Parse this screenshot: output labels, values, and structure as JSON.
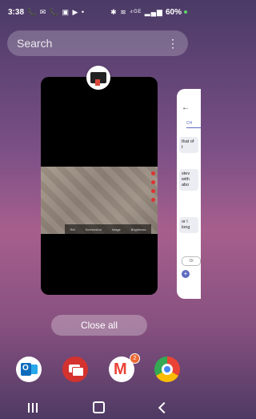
{
  "status_bar": {
    "time": "3:38",
    "left_icons": "📞 ✉ 📞 ▣ ▶ •",
    "right_icons": "✱ ≋ ⁴ᴳᴱ ▂▄▆",
    "battery": "60%",
    "left_icon_names": [
      "phone-icon",
      "voicemail-icon",
      "phone-icon",
      "gallery-icon",
      "youtube-icon"
    ],
    "right_icon_names": [
      "bluetooth-icon",
      "wifi-icon",
      "lte-icon",
      "signal-icon"
    ]
  },
  "search": {
    "placeholder": "Search"
  },
  "recent_app": {
    "name": "connect"
  },
  "side_card": {
    "tab": "CH",
    "messages": [
      "that of t",
      "stev with abo",
      "or l long"
    ],
    "chip": "Ol"
  },
  "close_all": {
    "label": "Close all"
  },
  "dock": {
    "apps": [
      "Outlook",
      "Messages",
      "Gmail",
      "Chrome"
    ],
    "gmail_badge": "2"
  },
  "preview_toolbar": [
    "Ref",
    "Screenshot",
    "Image",
    "Brightness"
  ],
  "colors": {
    "accent": "#5c6bc0",
    "badge": "#ea6a35"
  }
}
